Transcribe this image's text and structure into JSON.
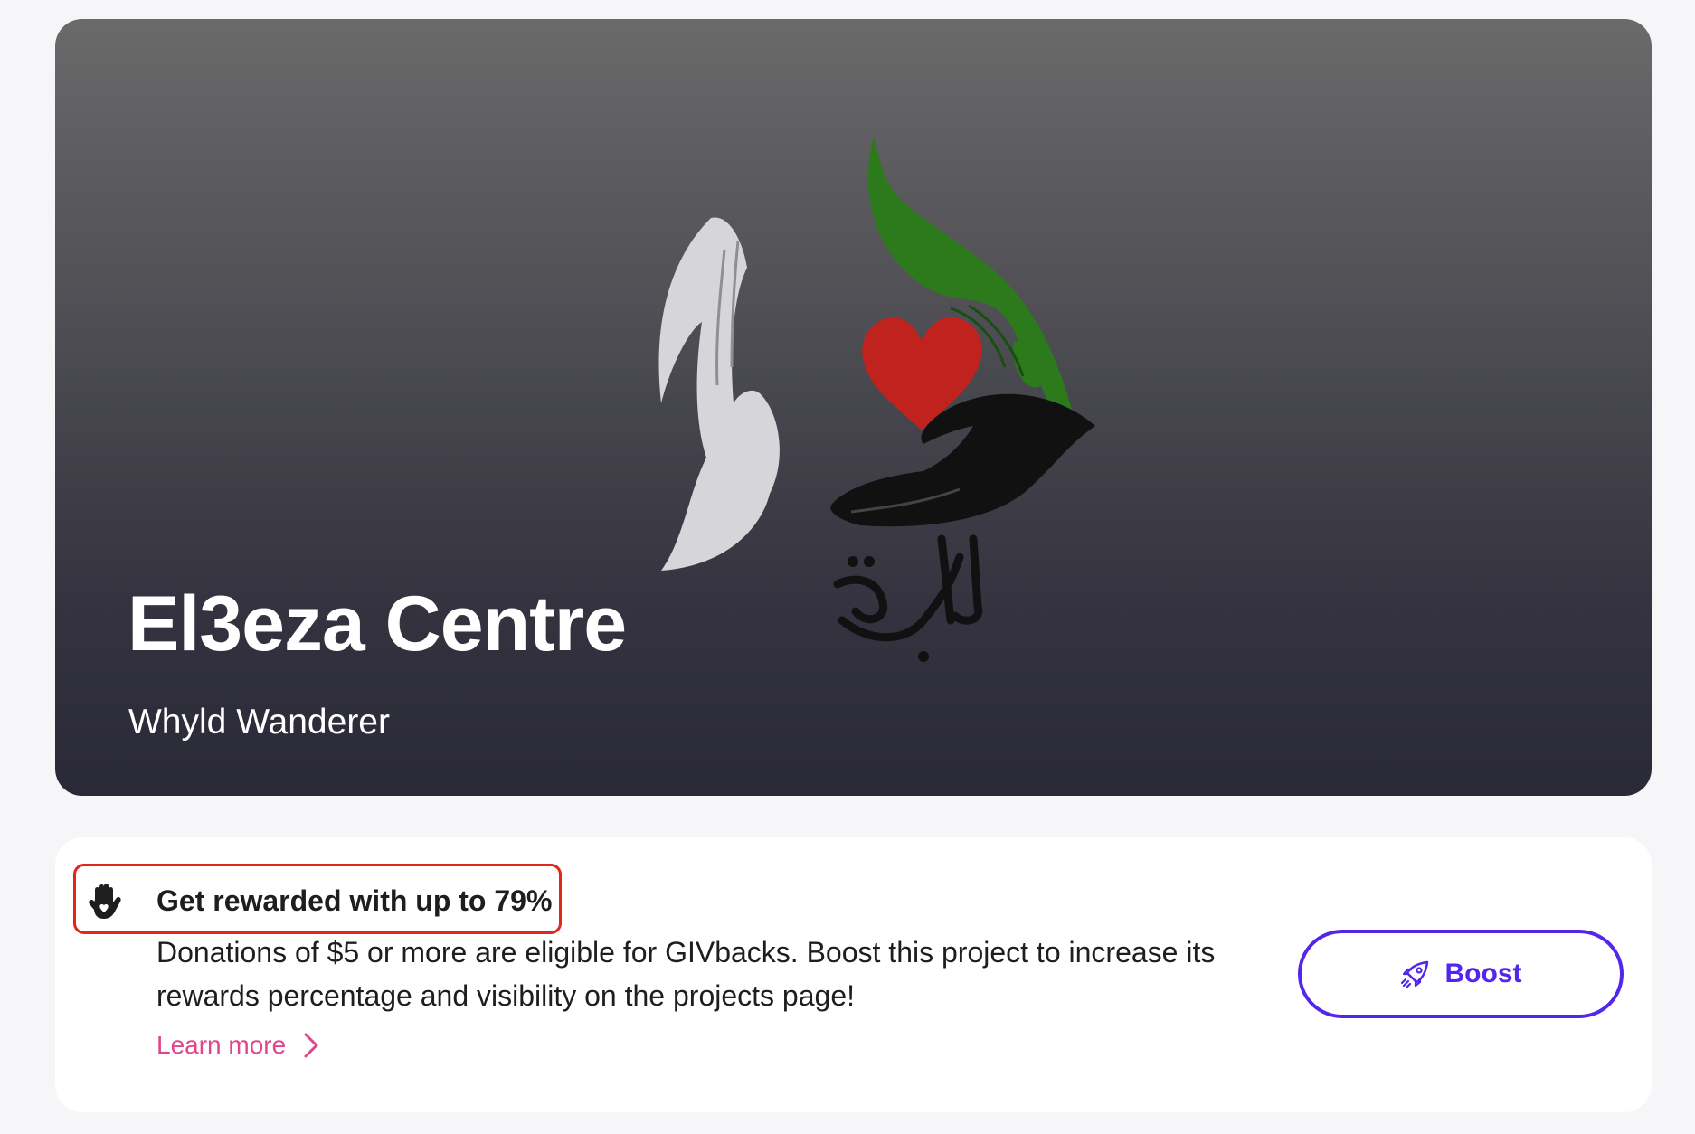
{
  "project": {
    "title": "El3eza Centre",
    "author": "Whyld Wanderer",
    "logo_icon": "el3eza-logo-hands-heart-icon",
    "logo_colors": {
      "heart": "#c0231d",
      "green_hand": "#2c7a1c",
      "white_hand": "#d8d8dc",
      "black_hand": "#111111"
    }
  },
  "givbacks": {
    "icon": "givback-hand-heart-icon",
    "title": "Get rewarded with up to 79%",
    "description": "Donations of $5 or more are eligible for GIVbacks. Boost this project to increase its rewards percentage and visibility on the projects page!",
    "learn_more_label": "Learn more",
    "learn_more_icon": "chevron-right-icon",
    "boost_label": "Boost",
    "boost_icon": "rocket-icon",
    "colors": {
      "highlight_border": "#e1261c",
      "link": "#e1458d",
      "boost": "#5326ec"
    }
  }
}
